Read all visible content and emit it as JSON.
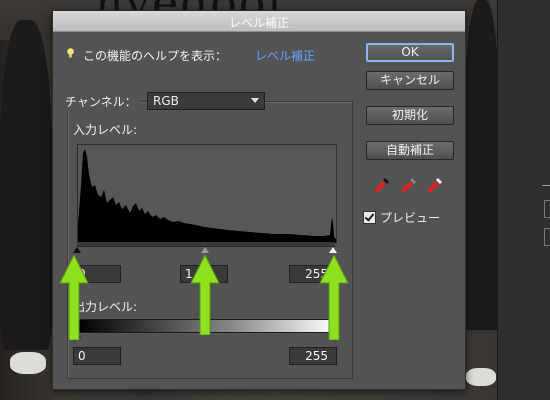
{
  "dialog": {
    "title": "レベル補正",
    "help_text": "この機能のヘルプを表示：",
    "help_link": "レベル補正"
  },
  "channel": {
    "label": "チャンネル：",
    "value": "RGB"
  },
  "input_levels": {
    "label": "入力レベル:",
    "black": "0",
    "gamma": "1.00",
    "white": "255"
  },
  "output_levels": {
    "label": "出力レベル:",
    "black": "0",
    "white": "255"
  },
  "buttons": {
    "ok": "OK",
    "cancel": "キャンセル",
    "reset": "初期化",
    "auto": "自動補正"
  },
  "preview": {
    "label": "プレビュー",
    "checked": true
  },
  "icons": [
    "lightbulb-icon",
    "black-eyedropper-icon",
    "gray-eyedropper-icon",
    "white-eyedropper-icon"
  ],
  "colors": {
    "link": "#63a3ff",
    "annotation_arrow": "#8fe01f"
  }
}
